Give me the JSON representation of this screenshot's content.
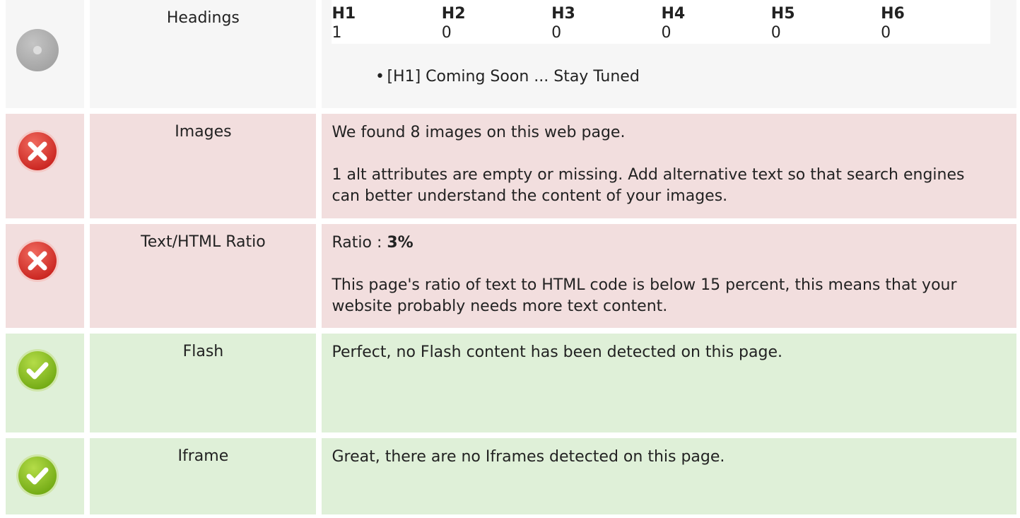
{
  "colors": {
    "neutral_bg": "#f6f6f6",
    "error_bg": "#f2dede",
    "ok_bg": "#dff0d8",
    "error_icon": "#d9302b",
    "ok_icon": "#8bc220",
    "neutral_icon": "#aaaaaa"
  },
  "rows": {
    "headings": {
      "label": "Headings",
      "icon": "neutral-circle-icon",
      "columns": [
        "H1",
        "H2",
        "H3",
        "H4",
        "H5",
        "H6"
      ],
      "counts": [
        "1",
        "0",
        "0",
        "0",
        "0",
        "0"
      ],
      "items": [
        "[H1] Coming Soon ... Stay Tuned"
      ]
    },
    "images": {
      "label": "Images",
      "icon": "error-cross-icon",
      "line1": "We found 8 images on this web page.",
      "line2": "1 alt attributes are empty or missing. Add alternative text so that search engines can better understand the content of your images."
    },
    "ratio": {
      "label": "Text/HTML Ratio",
      "icon": "error-cross-icon",
      "ratio_prefix": "Ratio : ",
      "ratio_value": "3%",
      "description": "This page's ratio of text to HTML code is below 15 percent, this means that your website probably needs more text content."
    },
    "flash": {
      "label": "Flash",
      "icon": "success-check-icon",
      "text": "Perfect, no Flash content has been detected on this page."
    },
    "iframe": {
      "label": "Iframe",
      "icon": "success-check-icon",
      "text": "Great, there are no Iframes detected on this page."
    }
  }
}
